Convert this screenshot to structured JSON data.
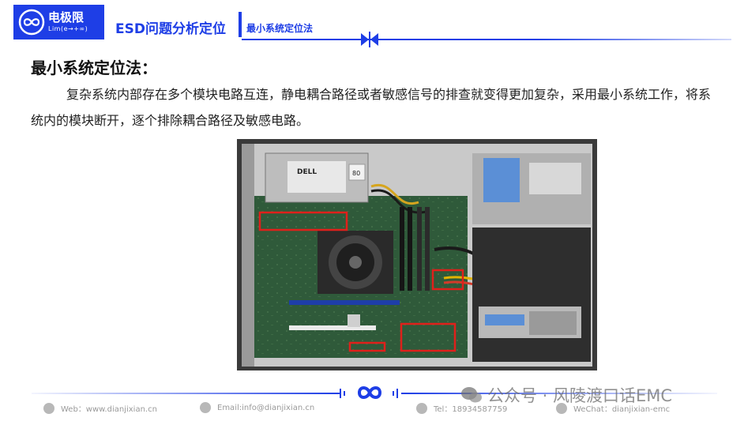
{
  "header": {
    "logo_cn": "电极限",
    "logo_en": "Lim(e→+∞)",
    "title": "ESD问题分析定位",
    "subtitle": "最小系统定位法"
  },
  "content": {
    "heading": "最小系统定位法：",
    "paragraph": "复杂系统内部存在多个模块电路互连，静电耦合路径或者敏感信号的排查就变得更加复杂，采用最小系统工作，将系统内的模块断开，逐个排除耦合路径及敏感电路。"
  },
  "photo": {
    "psu_brand": "DELL",
    "psu_badge": "80",
    "highlight_color": "#e0201b"
  },
  "footer": {
    "web": "Web：www.dianjixian.cn",
    "email": "Email:info@dianjixian.cn",
    "tel": "Tel：18934587759",
    "wechat": "WeChat：dianjixian-emc",
    "watermark": "公众号 · 风陵渡口话EMC"
  },
  "colors": {
    "brand_blue": "#1e3ee6",
    "accent_red": "#e0201b"
  }
}
